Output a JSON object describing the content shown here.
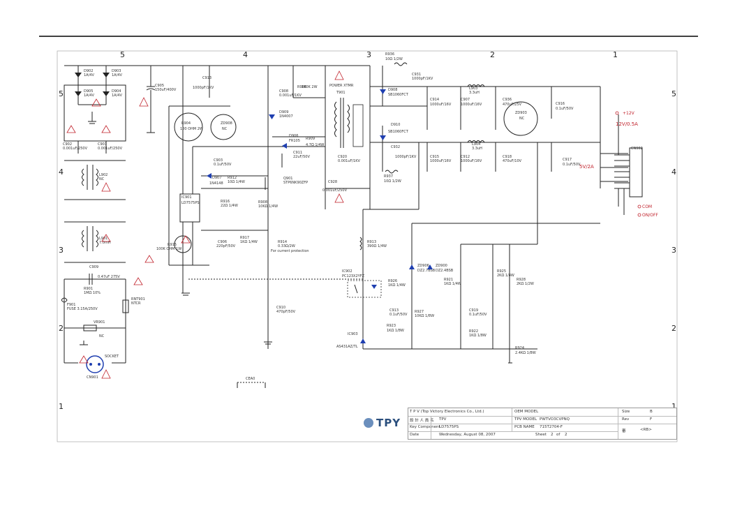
{
  "zones_top": [
    "5",
    "4",
    "3",
    "2",
    "1"
  ],
  "zones_side": [
    "5",
    "4",
    "3",
    "2",
    "1"
  ],
  "components": {
    "d902": "D902",
    "d902_v": "1A/4V",
    "d903": "D903",
    "d903_v": "1A/4V",
    "d905": "D905",
    "d905_v": "1A/4V",
    "d904": "D904",
    "d904_v": "1A/4V",
    "c905": "C905",
    "c905_v": "150uF/400V",
    "c913": "C913",
    "c913_v": "1000pF/1KV",
    "c902": "C902",
    "c902_v": "0.001uF/250V",
    "c901": "C901",
    "c901_v": "0.001uF/250V",
    "l902": "L902",
    "l902_v": "NC",
    "l901": "L901",
    "l901_v": "7.0mH",
    "c909": "C909",
    "c909_v": "0.47uF 275V",
    "r901": "R901",
    "r901_v": "1MΩ 10%",
    "f901": "F901",
    "f901_v": "FUSE 3.15A/250V",
    "rnt901": "RNT901",
    "rnt901_v": "NTCR",
    "vr901": "VR901",
    "vr901_v": "NC",
    "cn901": "CN901",
    "cn901_v": "SOCKET",
    "r904": "R904",
    "r904_v": "100 OHM 2W",
    "zd908": "ZD908",
    "zd908_v": "NC",
    "c903": "C903",
    "c903_v": "0.1uF/50V",
    "d907": "D907",
    "d907_v": "1N4148",
    "r912": "R912",
    "r912_v": "10Ω 1/4W",
    "r916": "R916",
    "r916_v": "22Ω 1/4W",
    "ic901": "IC901",
    "ic901_v": "LD7575PS",
    "r915": "R915",
    "r915_v": "100K OHM 1W",
    "c906": "C906",
    "c906_v": "220pF/50V",
    "r917": "R917",
    "r917_v": "1KΩ 1/4W",
    "r914": "R914",
    "r914_v": "0.33Ω/2W",
    "r914_note": "For current protection",
    "r908": "R908",
    "r908_v": "10KΩ 1/4W",
    "q901": "Q901",
    "q901_v": "STP6NK90ZFP",
    "c908": "C908",
    "c908_v": "0.001uF/1KV",
    "d909": "D909",
    "d909_v": "1N4007",
    "r906": "R906",
    "r906_v": "100K 2W",
    "d906": "D906",
    "d906_v": "FR105",
    "r909": "R909",
    "r909_v": "4.7Ω 1/4W",
    "c911": "C911",
    "c911_v": "22uF/50V",
    "t901": "T901",
    "t901_v": "POWER XTMR",
    "c920": "C920",
    "c920_v": "0.001uF/1KV",
    "c928": "C928",
    "c928_v": "0.001uF/250V",
    "c910": "C910",
    "c910_v": "470pF/50V",
    "r936": "R936",
    "r936_v": "10Ω 1/2W",
    "c931": "C931",
    "c931_v": "1000pF/1KV",
    "d908": "D908",
    "d908_v": "SB1060FCT",
    "d910": "D910",
    "d910_v": "SB1060FCT",
    "c932": "C932",
    "c932_v": "1000pF/1KV",
    "r937": "R937",
    "r937_v": "10Ω 1/2W",
    "c914": "C914",
    "c914_v": "1000uF/16V",
    "c907": "C907",
    "c907_v": "1000uF/16V",
    "l903": "L903",
    "l903_v": "3.3uH",
    "c906b": "C936",
    "c906b_v": "470uF/25V",
    "zd903": "ZD903",
    "zd903_v": "NC",
    "c916": "C916",
    "c916_v": "0.1uF/50V",
    "c915": "C915",
    "c915_v": "1000uF/16V",
    "c912": "C912",
    "c912_v": "1000uF/16V",
    "l901b": "L904",
    "l901b_v": "3.3uH",
    "c918": "C918",
    "c918_v": "470uF/10V",
    "c917": "C917",
    "c917_v": "0.1uF/50V",
    "cn902": "CN902",
    "r913": "R913",
    "r913_v": "390Ω 1/4W",
    "ic902": "IC902",
    "ic902_v": "PC123X2YFZ",
    "zd906": "ZD906",
    "zd906_v": "DZ2.7BSB",
    "zd900": "ZD900",
    "zd900_v": "DZ2.4BSB",
    "r926": "R926",
    "r926_v": "1KΩ 1/4W",
    "c919": "C919",
    "c919_v": "0.1uF/50V",
    "r928": "R928",
    "r928_v": "2KΩ 1/2W",
    "r925": "R925",
    "r925_v": "2KΩ 1/4W",
    "r921": "R921",
    "r921_v": "1KΩ 1/4W",
    "r927": "R927",
    "r927_v": "10KΩ 1/8W",
    "c913b": "C913",
    "c913b_v": "0.1uF/50V",
    "r923": "R923",
    "r923_v": "1KΩ 1/8W",
    "r924": "R924",
    "r924_v": "2.4KΩ 1/8W",
    "r922": "R922",
    "r922_v": "1KΩ 1/8W",
    "ic903": "IC903",
    "ic903_v": "AS431AZ/TL",
    "gnd_cap": "CEA0"
  },
  "labels": {
    "v12": "+12V",
    "v12_rating": "12V/0.5A",
    "v5_rating": "5V/2A",
    "com": "COM",
    "on_off": "ON/OFF"
  },
  "title_block": {
    "company": "T P V   (Top   Victory   Electronics   Co.,   Ltd.)",
    "oem_model_label": "OEM MODEL",
    "size_label": "Size",
    "size_value": "B",
    "designer_label": "設 計 人 員 名",
    "designer_value": "TPV",
    "tpv_model_label": "TPV MODEL",
    "tpv_model_value": "PWTVO3CVPNQ",
    "rev_label": "Rev",
    "rev_value": "F",
    "key_component_label": "Key Component",
    "key_component_value": "LD7575PS",
    "pcb_name_label": "PCB NAME",
    "pcb_name_value": "715T2704-F",
    "date_label": "Date",
    "date_value": "Wednesday, August 08, 2007",
    "sheet_label": "Sheet",
    "sheet_value": "2",
    "of_label": "of",
    "of_value": "2",
    "extra_label": "審",
    "extra_value": "<RB>",
    "logo_text": "TPY"
  },
  "colors": {
    "wire": "#222222",
    "warning": "#c0202a",
    "text": "#333333"
  }
}
